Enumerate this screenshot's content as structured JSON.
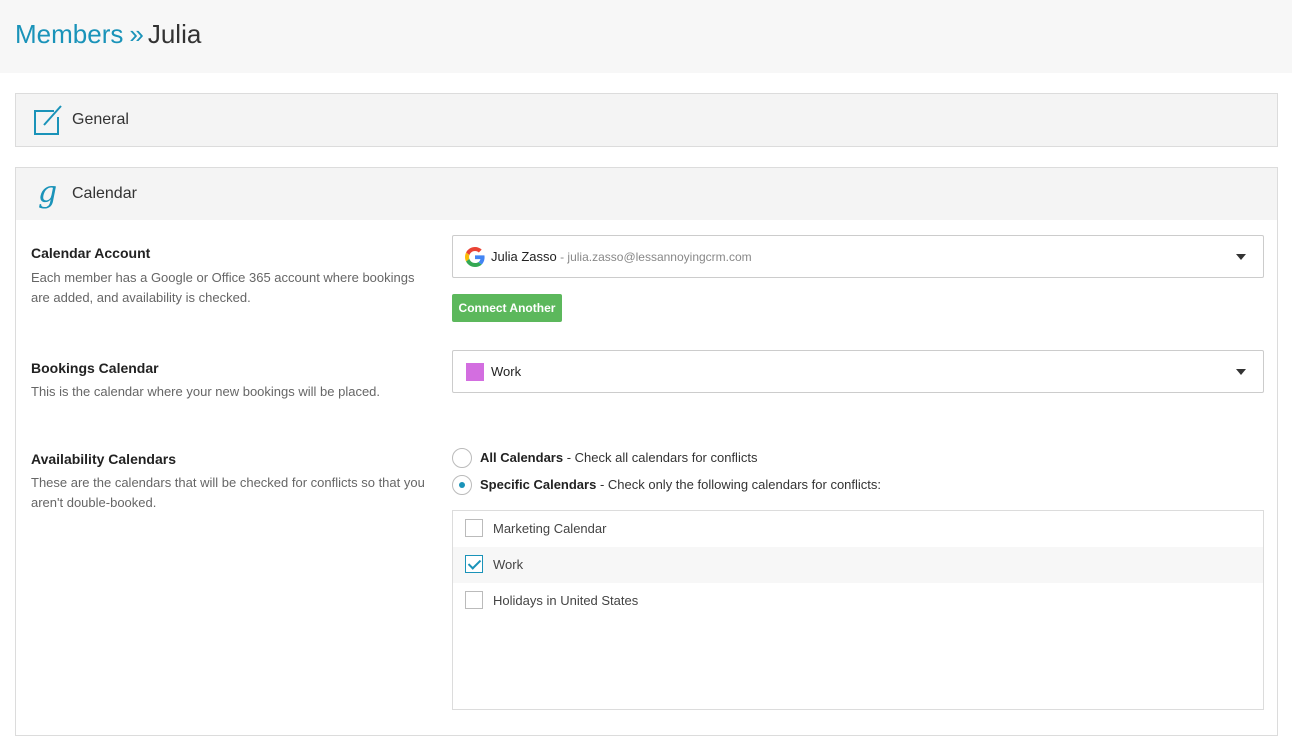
{
  "breadcrumb": {
    "parent": "Members",
    "separator": "»",
    "current": "Julia"
  },
  "sections": {
    "general": {
      "title": "General",
      "icon": "edit-icon"
    },
    "calendar": {
      "title": "Calendar",
      "icon": "google-g-icon",
      "glyph": "g"
    }
  },
  "calendar_account": {
    "label": "Calendar Account",
    "description": "Each member has a Google or Office 365 account where bookings are added, and availability is checked.",
    "selected_name": "Julia Zasso",
    "selected_email": " - julia.zasso@lessannoyingcrm.com",
    "connect_button": "Connect Another"
  },
  "bookings_calendar": {
    "label": "Bookings Calendar",
    "description": "This is the calendar where your new bookings will be placed.",
    "selected": "Work",
    "swatch_color": "#d36ee0"
  },
  "availability": {
    "label": "Availability Calendars",
    "description": "These are the calendars that will be checked for conflicts so that you aren't double-booked.",
    "options": [
      {
        "title": "All Calendars",
        "text": " - Check all calendars for conflicts",
        "checked": false
      },
      {
        "title": "Specific Calendars",
        "text": " - Check only the following calendars for conflicts:",
        "checked": true
      }
    ],
    "calendars": [
      {
        "name": "Marketing Calendar",
        "checked": false
      },
      {
        "name": "Work",
        "checked": true
      },
      {
        "name": "Holidays in United States",
        "checked": false
      }
    ]
  },
  "colors": {
    "accent": "#1a93b9",
    "button_green": "#5cb85c"
  }
}
